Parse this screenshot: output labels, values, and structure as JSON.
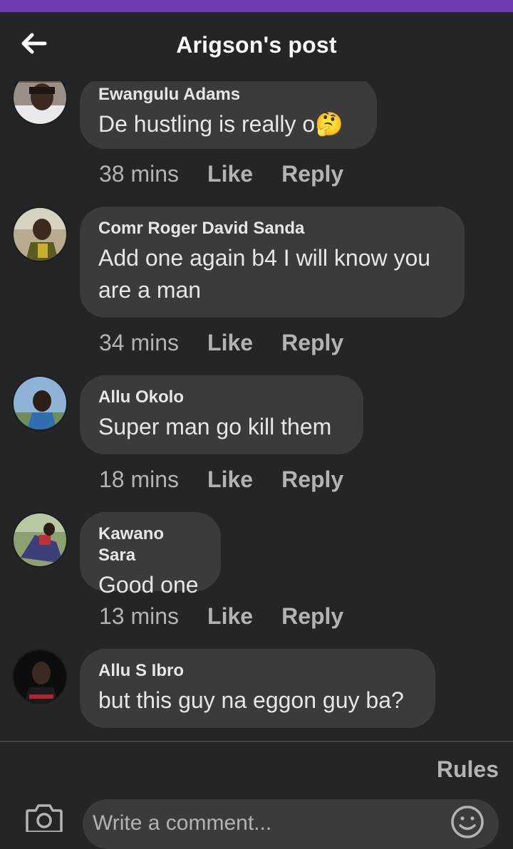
{
  "header": {
    "title": "Arigson's post"
  },
  "comments": [
    {
      "author": "Ewangulu Adams",
      "text": "De hustling is really o",
      "emoji": "🤔",
      "time": "38 mins",
      "like": "Like",
      "reply": "Reply"
    },
    {
      "author": "Comr Roger David Sanda",
      "text": "Add one again b4 I will know you are a man",
      "time": "34 mins",
      "like": "Like",
      "reply": "Reply"
    },
    {
      "author": "Allu Okolo",
      "text": "Super man go kill them",
      "time": "18 mins",
      "like": "Like",
      "reply": "Reply"
    },
    {
      "author": "Kawano Sara",
      "text": "Good one",
      "time": "13 mins",
      "like": "Like",
      "reply": "Reply"
    },
    {
      "author": "Allu S Ibro",
      "text": "but this guy na eggon guy ba?"
    }
  ],
  "footer": {
    "rules": "Rules",
    "placeholder": "Write a comment..."
  },
  "icons": {
    "back": "arrow-left-icon",
    "camera": "camera-icon",
    "emoji": "smiley-icon"
  },
  "colors": {
    "status_bar": "#6f3ab2",
    "background": "#242526",
    "bubble": "#3a3b3c"
  }
}
